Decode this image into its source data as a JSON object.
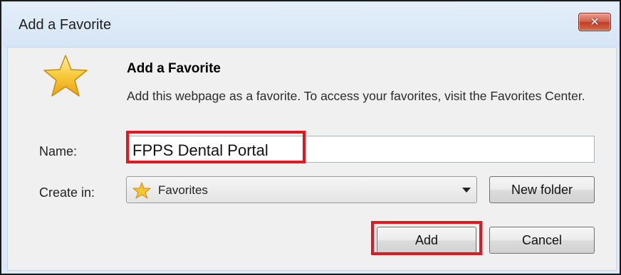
{
  "window": {
    "title": "Add a Favorite",
    "close_icon": "close-icon"
  },
  "header": {
    "icon": "star-icon",
    "heading": "Add a Favorite",
    "description": "Add this webpage as a favorite. To access your favorites, visit the Favorites Center."
  },
  "form": {
    "name_label": "Name:",
    "name_value": "FPPS Dental Portal",
    "create_in_label": "Create in:",
    "create_in_selected": "Favorites",
    "create_in_icon": "favorites-star-icon",
    "new_folder_label": "New folder"
  },
  "actions": {
    "add_label": "Add",
    "cancel_label": "Cancel"
  },
  "annotations": {
    "highlight_color": "#e4161f"
  },
  "colors": {
    "titlebar": "#d6e5f5",
    "close_button": "#c23d25",
    "content_background": "#f0f0f0"
  }
}
